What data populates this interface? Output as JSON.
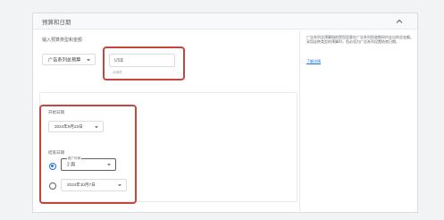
{
  "panel": {
    "title": "预算和日期"
  },
  "budget": {
    "label": "输入预算类型和金额",
    "type_selected": "广告系列总预算",
    "amount_currency": "US$",
    "amount_helper": "必填项"
  },
  "dates": {
    "start_label": "开始日期",
    "start_value": "2024年9月23日",
    "end_label": "结束日期",
    "duration_legend": "推广时间",
    "duration_value": "2 周",
    "end_date_value": "2024年10月7日"
  },
  "info": {
    "text": "广告系列总预算指的是您愿意在广告系列投放期间内支出的总金额。采用这种类型的预算时，您必须为广告系列设置结束日期。",
    "learn_more": "了解详情"
  },
  "colors": {
    "highlight": "#c5463e",
    "accent": "#1a73e8"
  }
}
